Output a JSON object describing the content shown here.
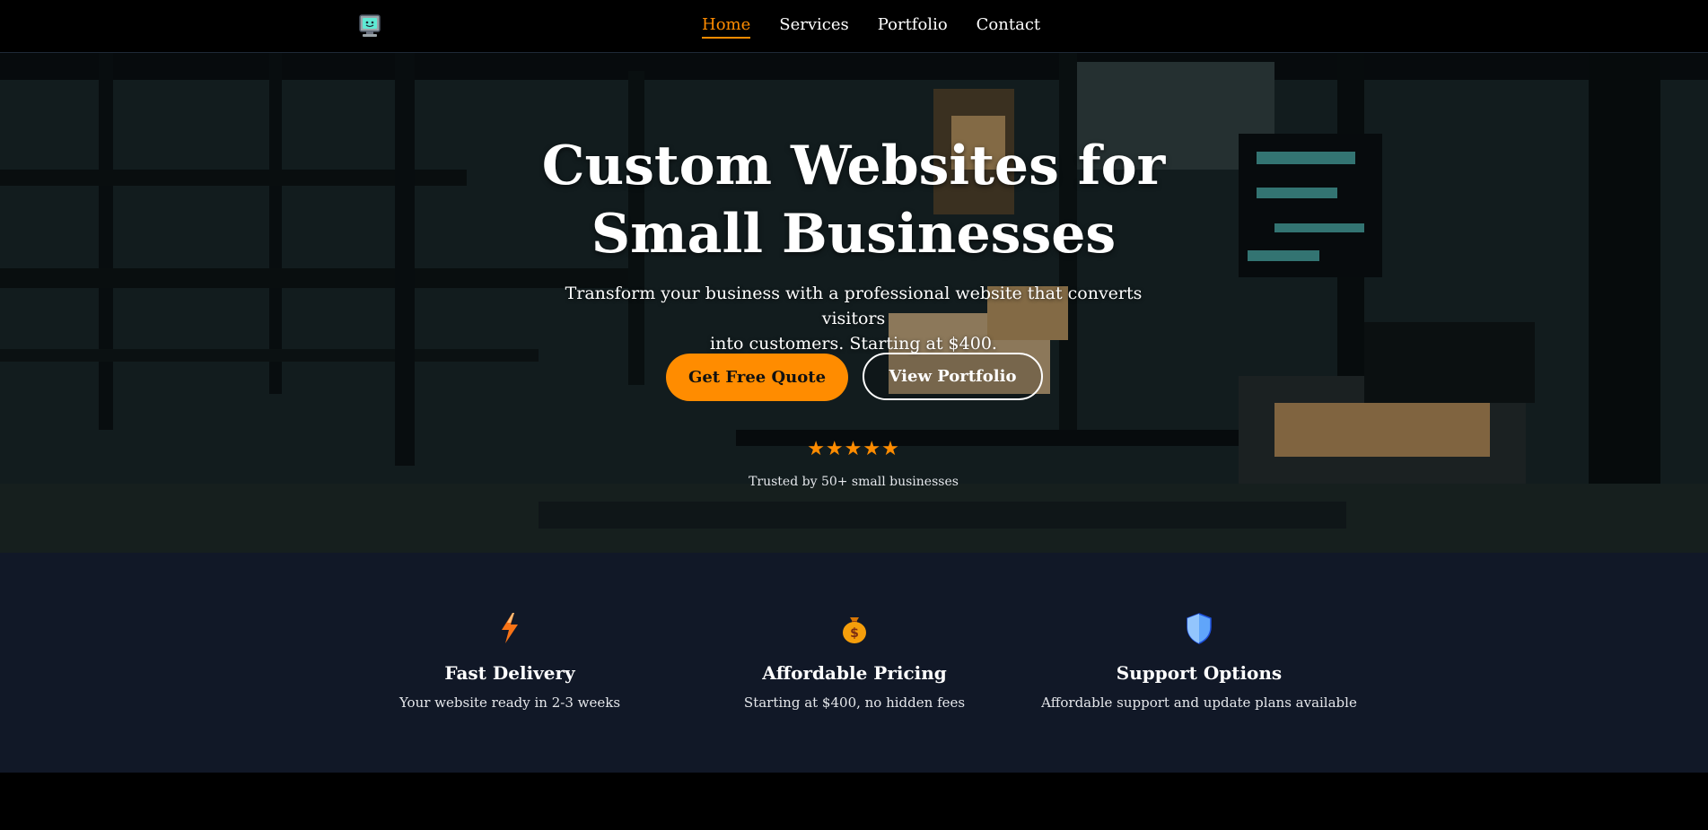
{
  "nav": {
    "logo_icon": "computer-face-icon",
    "links": [
      {
        "label": "Home",
        "active": true
      },
      {
        "label": "Services",
        "active": false
      },
      {
        "label": "Portfolio",
        "active": false
      },
      {
        "label": "Contact",
        "active": false
      }
    ]
  },
  "hero": {
    "title_line1": "Custom Websites for",
    "title_line2": "Small Businesses",
    "subtitle_line1": "Transform your business with a professional website that converts visitors",
    "subtitle_line2": "into customers. Starting at $400.",
    "primary_button": "Get Free Quote",
    "secondary_button": "View Portfolio",
    "rating_stars": "★★★★★",
    "rating_value": 5,
    "trusted_text": "Trusted by 50+ small businesses"
  },
  "features": [
    {
      "icon": "lightning-icon",
      "title": "Fast Delivery",
      "description": "Your website ready in 2-3 weeks"
    },
    {
      "icon": "money-bag-icon",
      "title": "Affordable Pricing",
      "description": "Starting at $400, no hidden fees"
    },
    {
      "icon": "shield-icon",
      "title": "Support Options",
      "description": "Affordable support and update plans available"
    }
  ],
  "colors": {
    "accent": "#ff8c00",
    "nav_bg": "#000000",
    "features_bg": "#111827"
  }
}
